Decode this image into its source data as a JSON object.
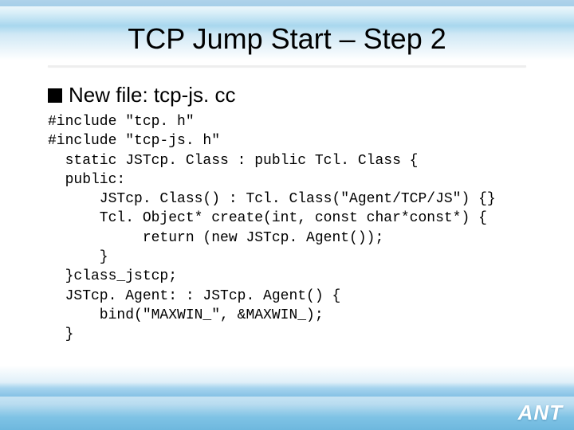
{
  "slide": {
    "title": "TCP Jump Start – Step 2",
    "bullet": "New file: tcp-js. cc",
    "code": "#include \"tcp. h\"\n#include \"tcp-js. h\"\n  static JSTcp. Class : public Tcl. Class {\n  public:\n      JSTcp. Class() : Tcl. Class(\"Agent/TCP/JS\") {}\n      Tcl. Object* create(int, const char*const*) {\n           return (new JSTcp. Agent());\n      }\n  }class_jstcp;\n  JSTcp. Agent: : JSTcp. Agent() {\n      bind(\"MAXWIN_\", &MAXWIN_);\n  }",
    "logo": "ANT"
  }
}
